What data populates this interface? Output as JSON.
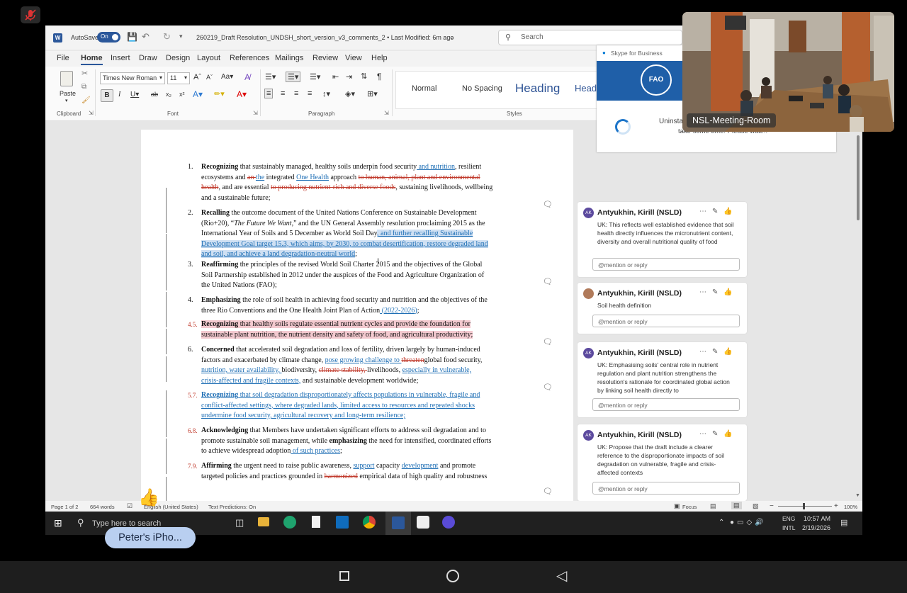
{
  "colors": {
    "word_blue": "#2b579a",
    "track_insert": "#1f6fb5",
    "track_delete": "#c0392b",
    "avatar": "#5c4a9e"
  },
  "titlebar": {
    "autosave_label": "AutoSave",
    "autosave_state": "On",
    "filename": "260219_Draft Resolution_UNDSH_short_version_v3_comments_2 • Last Modified: 6m ago",
    "search_placeholder": "Search"
  },
  "menu": [
    "File",
    "Home",
    "Insert",
    "Draw",
    "Design",
    "Layout",
    "References",
    "Mailings",
    "Review",
    "View",
    "Help"
  ],
  "ribbon": {
    "paste": "Paste",
    "font_name": "Times New Roman",
    "font_size": "11",
    "groups": {
      "clipboard": "Clipboard",
      "font": "Font",
      "paragraph": "Paragraph",
      "styles": "Styles"
    },
    "styles": [
      "Normal",
      "No Spacing",
      "Heading",
      "Head"
    ]
  },
  "document": {
    "paragraphs": [
      {
        "num": "1.",
        "lines": [
          [
            {
              "t": "Recognizing",
              "b": true
            },
            {
              "t": " that sustainably managed, healthy soils underpin food security"
            },
            {
              "t": " and nutrition",
              "c": "ins"
            },
            {
              "t": ", resilient"
            }
          ],
          [
            {
              "t": "ecosystems and "
            },
            {
              "t": "an ",
              "c": "del"
            },
            {
              "t": "the",
              "c": "ins"
            },
            {
              "t": " integrated "
            },
            {
              "t": "One Health",
              "c": "ins"
            },
            {
              "t": " approach "
            },
            {
              "t": "to human, animal, plant and environmental",
              "c": "del"
            }
          ],
          [
            {
              "t": "health",
              "c": "del"
            },
            {
              "t": ", and are essential "
            },
            {
              "t": "to producing nutrient-rich and diverse foods",
              "c": "del"
            },
            {
              "t": ", sustaining livelihoods, wellbeing"
            }
          ],
          [
            {
              "t": "and a sustainable future;"
            }
          ]
        ]
      },
      {
        "num": "2.",
        "lines": [
          [
            {
              "t": "Recalling",
              "b": true
            },
            {
              "t": " the outcome document of the United Nations Conference on Sustainable Development"
            }
          ],
          [
            {
              "t": "(Rio+20), “"
            },
            {
              "t": "The Future We Want,",
              "i": true
            },
            {
              "t": "” and the UN General Assembly resolution proclaiming 2015 as the"
            }
          ],
          [
            {
              "t": "International Year of Soils and 5 December as World Soil Day"
            },
            {
              "t": ", and further recalling Sustainable",
              "c": "ins hlblue"
            }
          ],
          [
            {
              "t": "Development Goal target 15.3, which aims, by 2030, to combat desertification, restore degraded land",
              "c": "ins hlblue"
            }
          ],
          [
            {
              "t": "and soil, and achieve a land degradation-neutral world",
              "c": "ins hlblue"
            },
            {
              "t": ";"
            }
          ]
        ]
      },
      {
        "num": "3.",
        "lines": [
          [
            {
              "t": "Reaffirming",
              "b": true
            },
            {
              "t": " the principles of the revised World Soil Charter 2015 and the objectives of the Global"
            }
          ],
          [
            {
              "t": "Soil Partnership established in 2012 under the auspices of the Food and Agriculture Organization of"
            }
          ],
          [
            {
              "t": "the United Nations (FAO);"
            }
          ]
        ]
      },
      {
        "num": "4.",
        "lines": [
          [
            {
              "t": "Emphasizing",
              "b": true
            },
            {
              "t": " the role of soil health in achieving food security and nutrition and the objectives of the"
            }
          ],
          [
            {
              "t": "three Rio Conventions and the One Health Joint Plan of Action"
            },
            {
              "t": " (2022-2026)",
              "c": "ins"
            },
            {
              "t": ";"
            }
          ]
        ]
      },
      {
        "num": "4.5.",
        "lines": [
          [
            {
              "t": "Recognizing",
              "b": true,
              "c": "hlred"
            },
            {
              "t": " that healthy soils regulate essential nutrient cycles and provide the foundation for",
              "c": "hlred"
            }
          ],
          [
            {
              "t": "sustainable plant nutrition, the nutrient density and safety of food, and agricultural productivity;",
              "c": "hlred"
            }
          ]
        ]
      },
      {
        "num": "6.",
        "lines": [
          [
            {
              "t": "Concerned",
              "b": true
            },
            {
              "t": " that accelerated soil degradation and loss of fertility, driven largely by human-induced"
            }
          ],
          [
            {
              "t": "factors and exacerbated by climate change, "
            },
            {
              "t": "pose growing challenge to ",
              "c": "ins"
            },
            {
              "t": "threaten",
              "c": "del"
            },
            {
              "t": "global food security,"
            }
          ],
          [
            {
              "t": "nutrition, water availability, ",
              "c": "ins"
            },
            {
              "t": "biodiversity, "
            },
            {
              "t": "climate stability, ",
              "c": "del"
            },
            {
              "t": "livelihoods, "
            },
            {
              "t": "especially in vulnerable,",
              "c": "ins"
            }
          ],
          [
            {
              "t": "crisis-affected and fragile contexts,",
              "c": "ins"
            },
            {
              "t": " and sustainable development worldwide;"
            }
          ]
        ]
      },
      {
        "num": "5.7.",
        "lines": [
          [
            {
              "t": "Recognizing",
              "b": true,
              "c": "ins"
            },
            {
              "t": " that soil degradation disproportionately affects populations in vulnerable, fragile and",
              "c": "ins"
            }
          ],
          [
            {
              "t": "conflict-affected settings, where degraded lands, limited access to resources and repeated shocks",
              "c": "ins"
            }
          ],
          [
            {
              "t": "undermine food security, agricultural recovery and long-term resilience;",
              "c": "ins"
            }
          ]
        ]
      },
      {
        "num": "6.8.",
        "lines": [
          [
            {
              "t": "Acknowledging",
              "b": true
            },
            {
              "t": " that Members have undertaken significant efforts to address soil degradation and to"
            }
          ],
          [
            {
              "t": "promote sustainable soil management, while "
            },
            {
              "t": "emphasizing",
              "b": true
            },
            {
              "t": " the need for intensified, coordinated efforts"
            }
          ],
          [
            {
              "t": "to achieve widespread adoption"
            },
            {
              "t": " of such practices",
              "c": "ins"
            },
            {
              "t": ";"
            }
          ]
        ]
      },
      {
        "num": "7.9.",
        "lines": [
          [
            {
              "t": "Affirming",
              "b": true
            },
            {
              "t": " the urgent need to raise public awareness, "
            },
            {
              "t": "support",
              "c": "ins"
            },
            {
              "t": " capacity "
            },
            {
              "t": "development",
              "c": "ins"
            },
            {
              "t": " and promote"
            }
          ],
          [
            {
              "t": "targeted policies and practices grounded in "
            },
            {
              "t": "harmonized",
              "c": "del"
            },
            {
              "t": " empirical data of high quality and robustness"
            }
          ]
        ]
      }
    ]
  },
  "comments": [
    {
      "initials": "AK",
      "author": "Antyukhin, Kirill (NSLD)",
      "text": "UK: This reflects well established evidence that soil health directly influences the micronutrient content, diversity and overall nutritional quality of food",
      "reply_placeholder": "@mention or reply"
    },
    {
      "initials": "",
      "author": "Antyukhin, Kirill (NSLD)",
      "text": "Soil health definition",
      "reply_placeholder": "@mention or reply"
    },
    {
      "initials": "AK",
      "author": "Antyukhin, Kirill (NSLD)",
      "text": "UK: Emphasising soils' central role in nutrient regulation and plant nutrition strengthens the resolution's rationale for coordinated global action by linking soil health directly to",
      "reply_placeholder": "@mention or reply"
    },
    {
      "initials": "AK",
      "author": "Antyukhin, Kirill (NSLD)",
      "text": "UK: Propose that the draft include a clearer reference to the disproportionate impacts of soil degradation on vulnerable, fragile and crisis-affected contexts",
      "reply_placeholder": "@mention or reply"
    }
  ],
  "skype": {
    "title": "Skype for Business",
    "message_line1": "Uninsta",
    "message_line2": "take some time. Please wait..."
  },
  "video": {
    "label": "NSL-Meeting-Room"
  },
  "statusbar": {
    "page": "Page 1 of 2",
    "words": "664 words",
    "language": "English (United States)",
    "predictions": "Text Predictions: On",
    "focus": "Focus",
    "zoom": "100%"
  },
  "taskbar": {
    "search_placeholder": "Type here to search",
    "lang_top": "ENG",
    "lang_bottom": "INTL",
    "time": "10:57 AM",
    "date": "2/19/2026"
  },
  "participant": {
    "name": "Peter's iPho..."
  }
}
